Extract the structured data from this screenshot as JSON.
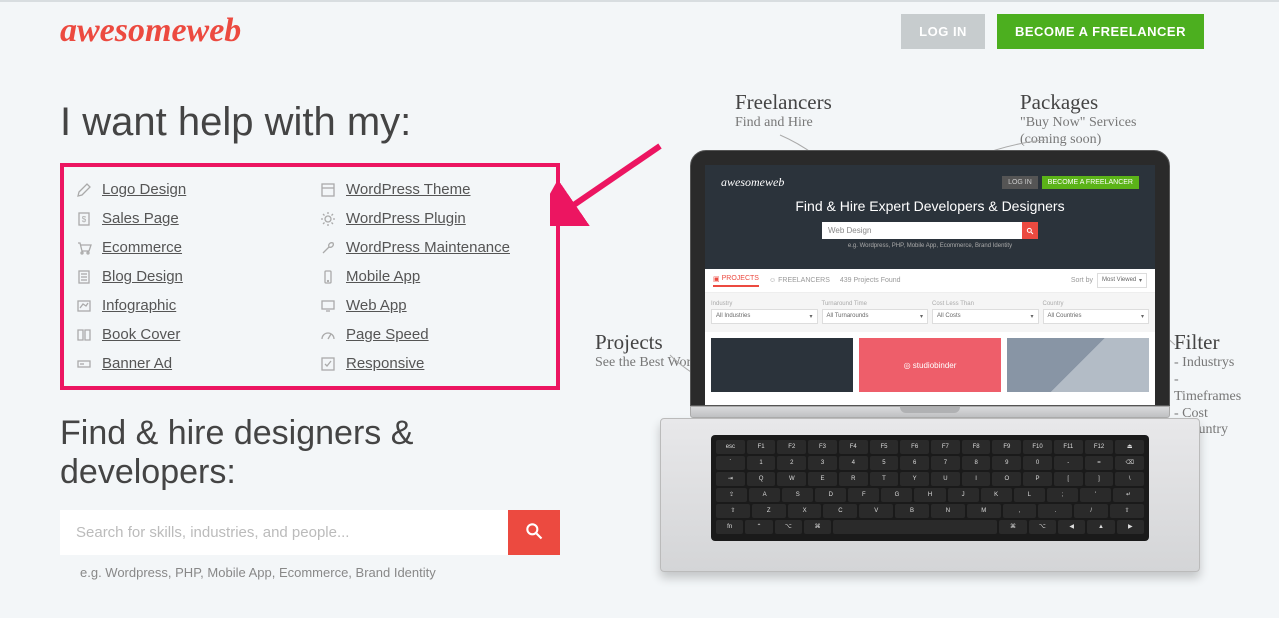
{
  "logo": "awesomeweb",
  "header": {
    "login": "LOG IN",
    "freelancer": "BECOME A FREELANCER"
  },
  "heading1": "I want help with my:",
  "categories": {
    "col1": [
      "Logo Design",
      "Sales Page",
      "Ecommerce",
      "Blog Design",
      "Infographic",
      "Book Cover",
      "Banner Ad"
    ],
    "col2": [
      "WordPress Theme",
      "WordPress Plugin",
      "WordPress Maintenance",
      "Mobile App",
      "Web App",
      "Page Speed",
      "Responsive"
    ]
  },
  "heading2": "Find & hire designers & developers:",
  "search": {
    "placeholder": "Search for skills, industries, and people...",
    "hint": "e.g. Wordpress, PHP, Mobile App, Ecommerce, Brand Identity"
  },
  "annotations": {
    "freelancers": {
      "title": "Freelancers",
      "sub": "Find and Hire"
    },
    "packages": {
      "title": "Packages",
      "sub1": "\"Buy Now\" Services",
      "sub2": "(coming soon)"
    },
    "projects": {
      "title": "Projects",
      "sub": "See the Best Work"
    },
    "filter": {
      "title": "Filter",
      "items": [
        "- Industrys",
        "- Timeframes",
        "- Cost",
        "- Country"
      ]
    }
  },
  "laptop": {
    "logo": "awesomeweb",
    "login": "LOG IN",
    "freelancer": "BECOME A FREELANCER",
    "title": "Find & Hire Expert Developers & Designers",
    "search_value": "Web Design",
    "hint": "e.g. Wordpress, PHP, Mobile App, Ecommerce, Brand Identity",
    "tab_projects": "PROJECTS",
    "tab_freelancers": "FREELANCERS",
    "found": "439 Projects Found",
    "sortby": "Sort by",
    "sort_value": "Most Viewed",
    "filter_labels": [
      "Industry",
      "Turnaround Time",
      "Cost Less Than",
      "Country"
    ],
    "filter_values": [
      "All Industries",
      "All Turnarounds",
      "All Costs",
      "All Countries"
    ],
    "card2_text": "◎ studiobinder"
  },
  "keys": {
    "r0": [
      "esc",
      "F1",
      "F2",
      "F3",
      "F4",
      "F5",
      "F6",
      "F7",
      "F8",
      "F9",
      "F10",
      "F11",
      "F12",
      "⏏"
    ],
    "r1": [
      "`",
      "1",
      "2",
      "3",
      "4",
      "5",
      "6",
      "7",
      "8",
      "9",
      "0",
      "-",
      "=",
      "⌫"
    ],
    "r2": [
      "⇥",
      "Q",
      "W",
      "E",
      "R",
      "T",
      "Y",
      "U",
      "I",
      "O",
      "P",
      "[",
      "]",
      "\\"
    ],
    "r3": [
      "⇪",
      "A",
      "S",
      "D",
      "F",
      "G",
      "H",
      "J",
      "K",
      "L",
      ";",
      "'",
      "↵"
    ],
    "r4": [
      "⇧",
      "Z",
      "X",
      "C",
      "V",
      "B",
      "N",
      "M",
      ",",
      ".",
      "/",
      "⇧"
    ],
    "r5": [
      "fn",
      "⌃",
      "⌥",
      "⌘",
      "",
      "⌘",
      "⌥",
      "◀",
      "▲",
      "▶"
    ]
  }
}
